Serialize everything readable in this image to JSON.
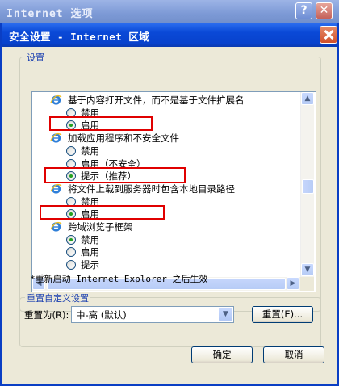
{
  "outer_window": {
    "title": "Internet 选项",
    "help_label": "?"
  },
  "dialog": {
    "title": "安全设置 - Internet 区域",
    "settings_group_label": "设置",
    "settings": [
      {
        "type": "folder",
        "label": "基于内容打开文件，而不是基于文件扩展名"
      },
      {
        "type": "option",
        "label": "禁用",
        "checked": false
      },
      {
        "type": "option",
        "label": "启用",
        "checked": true,
        "highlighted": true
      },
      {
        "type": "folder",
        "label": "加载应用程序和不安全文件"
      },
      {
        "type": "option",
        "label": "禁用",
        "checked": false
      },
      {
        "type": "option",
        "label": "启用（不安全）",
        "checked": false
      },
      {
        "type": "option",
        "label": "提示（推荐）",
        "checked": true,
        "highlighted": true
      },
      {
        "type": "folder",
        "label": "将文件上载到服务器时包含本地目录路径"
      },
      {
        "type": "option",
        "label": "禁用",
        "checked": false
      },
      {
        "type": "option",
        "label": "启用",
        "checked": true,
        "highlighted": true
      },
      {
        "type": "folder",
        "label": "跨域浏览子框架"
      },
      {
        "type": "option",
        "label": "禁用",
        "checked": true
      },
      {
        "type": "option",
        "label": "启用",
        "checked": false
      },
      {
        "type": "option",
        "label": "提示",
        "checked": false
      }
    ],
    "restart_note": "*重新启动 Internet Explorer 之后生效",
    "reset_group_label": "重置自定义设置",
    "reset_to_label": "重置为(R):",
    "reset_level_value": "中-高 (默认)",
    "reset_button": "重置(E)...",
    "ok_button": "确定",
    "cancel_button": "取消"
  },
  "colors": {
    "highlight_box": "#e00000",
    "title_bar": "#0a49d7",
    "group_label": "#1a3fb0"
  }
}
